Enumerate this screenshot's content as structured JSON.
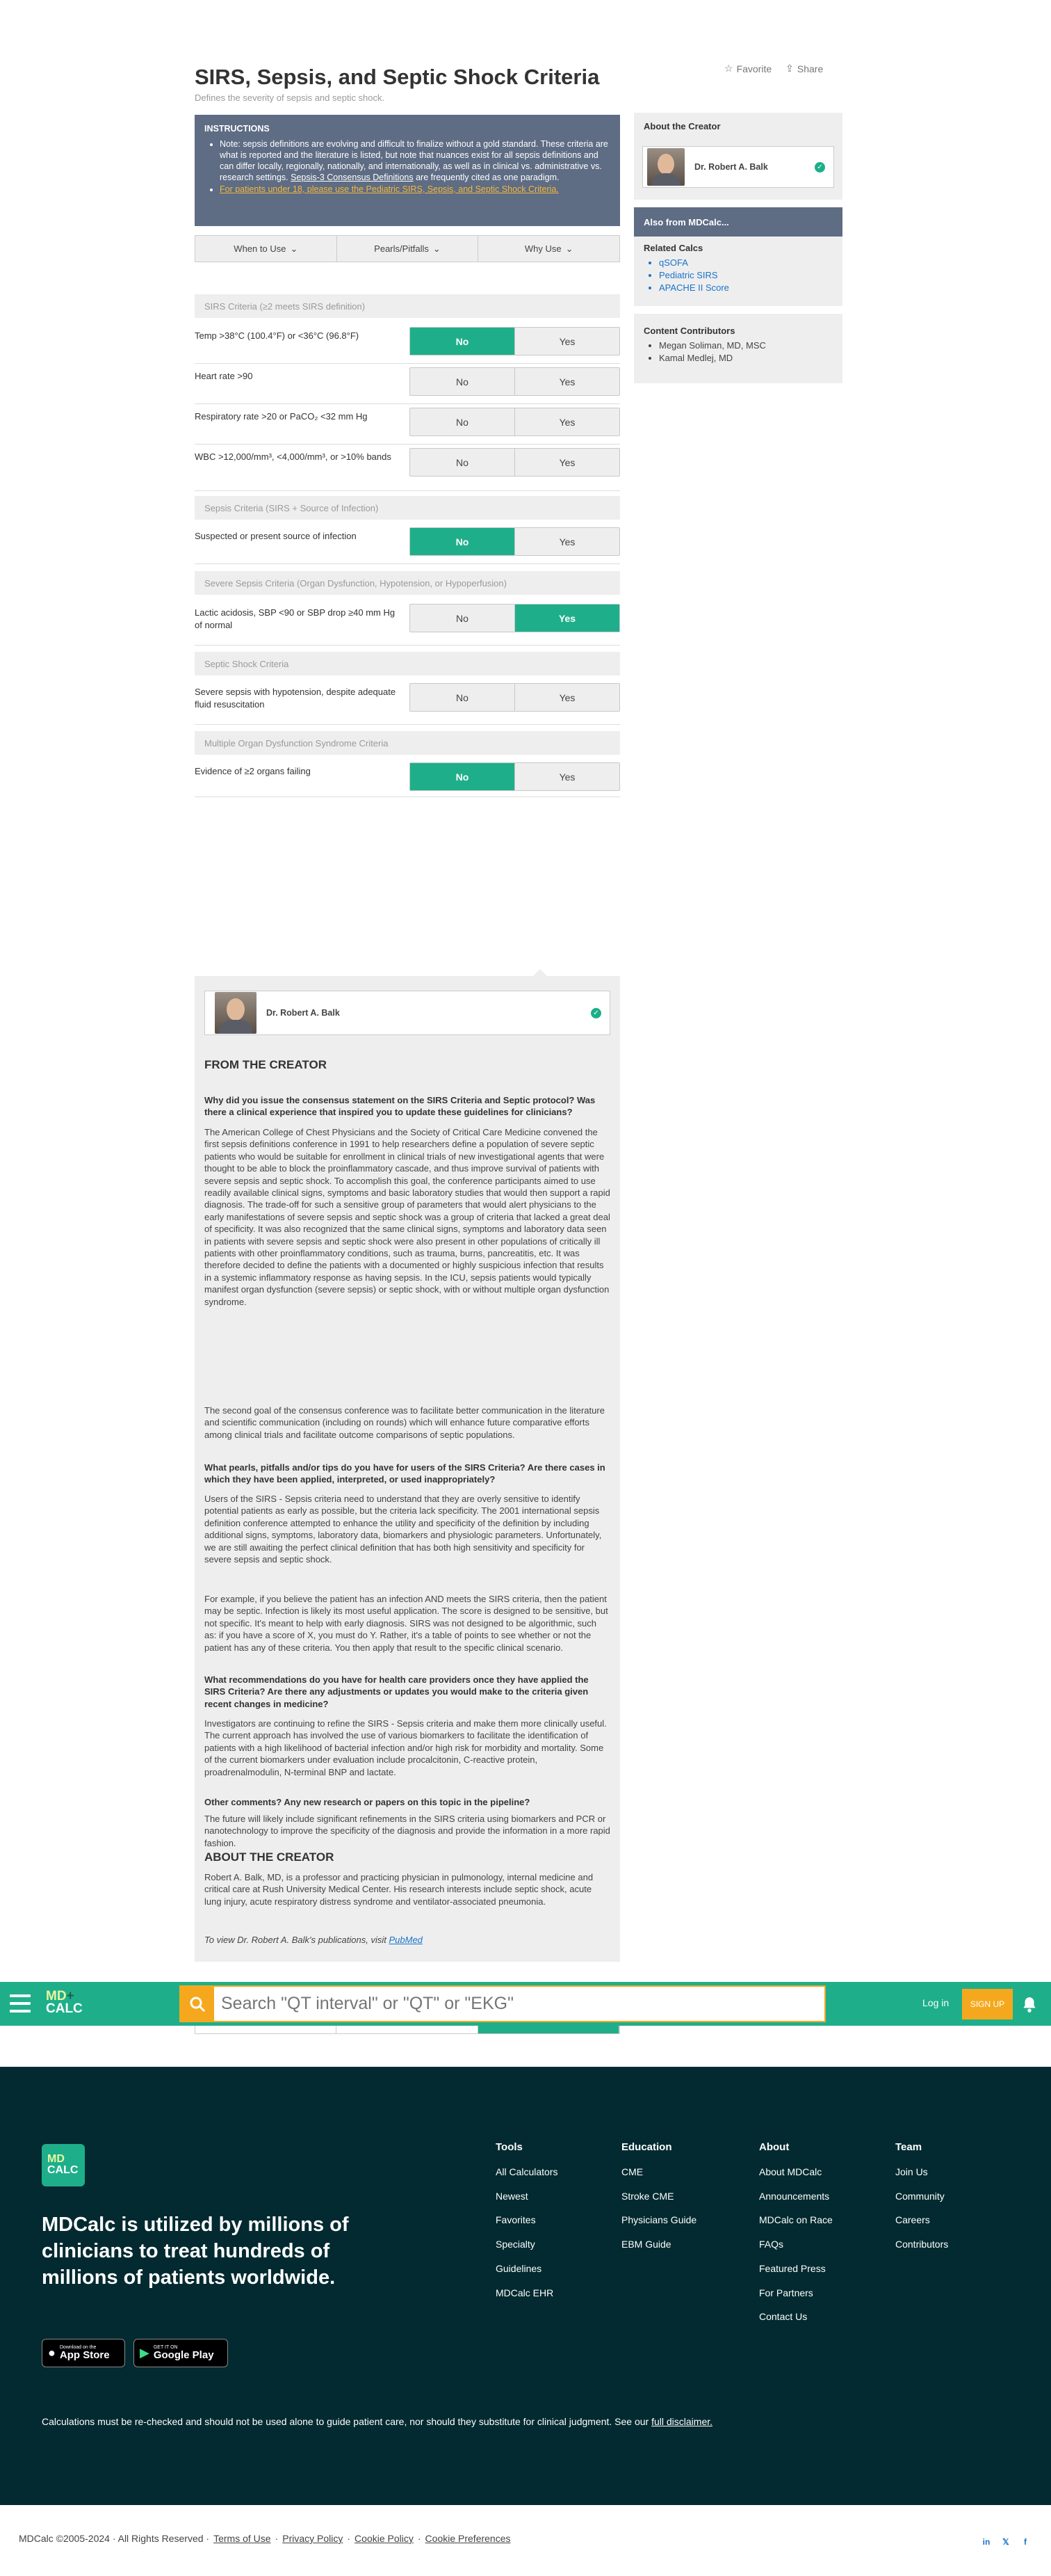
{
  "header": {
    "title": "SIRS, Sepsis, and Septic Shock Criteria",
    "subtitle": "Defines the severity of sepsis and septic shock.",
    "favorite": "Favorite",
    "share": "Share"
  },
  "instructions": {
    "heading": "INSTRUCTIONS",
    "note_text": "Note: sepsis definitions are evolving and difficult to finalize without a gold standard. These criteria are what is reported and the literature is listed, but note that nuances exist for all sepsis definitions and can differ locally, regionally, nationally, and internationally, as well as in clinical vs. administrative vs. research settings. ",
    "note_link": "Sepsis-3 Consensus Definitions",
    "note_tail": " are frequently cited as one paradigm.",
    "pediatric": "For patients under 18, please use the Pediatric SIRS, Sepsis, and Septic Shock Criteria."
  },
  "tabs": [
    "When to Use",
    "Pearls/Pitfalls",
    "Why Use"
  ],
  "sections": {
    "sirs": "SIRS Criteria (≥2 meets SIRS definition)",
    "sepsis": "Sepsis Criteria (SIRS + Source of Infection)",
    "severe": "Severe Sepsis Criteria (Organ Dysfunction, Hypotension, or Hypoperfusion)",
    "shock": "Septic Shock Criteria",
    "mods": "Multiple Organ Dysfunction Syndrome Criteria"
  },
  "criteria": [
    {
      "label": "Temp >38°C (100.4°F) or <36°C (96.8°F)",
      "selected": "No"
    },
    {
      "label": "Heart rate >90",
      "selected": "none"
    },
    {
      "label": "Respiratory rate >20 or PaCO₂ <32 mm Hg",
      "selected": "none"
    },
    {
      "label": "WBC >12,000/mm³, <4,000/mm³, or >10% bands",
      "selected": "none"
    },
    {
      "label": "Suspected or present source of infection",
      "selected": "No"
    },
    {
      "label": "Lactic acidosis, SBP <90 or SBP drop ≥40 mm Hg of normal",
      "selected": "Yes"
    },
    {
      "label": "Severe sepsis with hypotension, despite adequate fluid resuscitation",
      "selected": "none"
    },
    {
      "label": "Evidence of ≥2 organs failing",
      "selected": "No"
    }
  ],
  "toggle": {
    "no": "No",
    "yes": "Yes"
  },
  "sidebar": {
    "about_creator": "About the Creator",
    "creator_name": "Dr. Robert A. Balk",
    "also_from": "Also from MDCalc...",
    "related_title": "Related Calcs",
    "related": [
      "qSOFA",
      "Pediatric SIRS",
      "APACHE II Score"
    ],
    "contributors_title": "Content Contributors",
    "contributors": [
      "Megan Soliman, MD, MSC",
      "Kamal Medlej, MD"
    ]
  },
  "creator_panel": {
    "name": "Dr. Robert A. Balk",
    "from_heading": "FROM THE CREATOR",
    "q1": "Why did you issue the consensus statement on the SIRS Criteria and Septic protocol? Was there a clinical experience that inspired you to update these guidelines for clinicians?",
    "a1": "The American College of Chest Physicians and the Society of Critical Care Medicine convened the first sepsis definitions conference in 1991 to help researchers define a population of severe septic patients who would be suitable for enrollment in clinical trials of new investigational agents that were thought to be able to block the proinflammatory cascade, and thus improve survival of patients with severe sepsis and septic shock. To accomplish this goal, the conference participants aimed to use readily available clinical signs, symptoms and basic laboratory studies that would then support a rapid diagnosis. The trade-off for such a sensitive group of parameters that would alert physicians to the early manifestations of severe sepsis and septic shock was a group of criteria that lacked a great deal of specificity. It was also recognized that the same clinical signs, symptoms and laboratory data seen in patients with severe sepsis and septic shock were also present in other populations of critically ill patients with other proinflammatory conditions, such as trauma, burns, pancreatitis, etc. It was therefore decided to define the patients with a documented or highly suspicious infection that results in a systemic inflammatory response as having sepsis. In the ICU, sepsis patients would typically manifest organ dysfunction (severe sepsis) or septic shock, with or without multiple organ dysfunction syndrome.",
    "a1b": "The second goal of the consensus conference was to facilitate better communication in the literature and scientific communication (including on rounds) which will enhance future comparative efforts among clinical trials and facilitate outcome comparisons of septic populations.",
    "q2": "What pearls, pitfalls and/or tips do you have for users of the SIRS Criteria? Are there cases in which they have been applied, interpreted, or used inappropriately?",
    "a2": "Users of the SIRS - Sepsis criteria need to understand that they are overly sensitive to identify potential patients as early as possible, but the criteria lack specificity. The 2001 international sepsis definition conference attempted to enhance the utility and specificity of the definition by including additional signs, symptoms, laboratory data, biomarkers and physiologic parameters. Unfortunately, we are still awaiting the perfect clinical definition that has both high sensitivity and specificity for severe sepsis and septic shock.",
    "a2b": "For example, if you believe the patient has an infection AND meets the SIRS criteria, then the patient may be septic. Infection is likely its most useful application. The score is designed to be sensitive, but not specific. It's meant to help with early diagnosis. SIRS was not designed to be algorithmic, such as: if you have a score of X, you must do Y. Rather, it's a table of points to see whether or not the patient has any of these criteria. You then apply that result to the specific clinical scenario.",
    "q3": "What recommendations do you have for health care providers once they have applied the SIRS Criteria? Are there any adjustments or updates you would make to the criteria given recent changes in medicine?",
    "a3": "Investigators are continuing to refine the SIRS - Sepsis criteria and make them more clinically useful. The current approach has involved the use of various biomarkers to facilitate the identification of patients with a high likelihood of bacterial infection and/or high risk for morbidity and mortality. Some of the current biomarkers under evaluation include procalcitonin, C-reactive protein, proadrenalmodulin, N-terminal BNP and lactate.",
    "q4": "Other comments? Any new research or papers on this topic in the pipeline?",
    "a4": "The future will likely include significant refinements in the SIRS criteria using biomarkers and PCR or nanotechnology to improve the specificity of the diagnosis and provide the information in a more rapid fashion.",
    "about_heading": "ABOUT THE CREATOR",
    "about_text": "Robert A. Balk, MD, is a professor and practicing physician in pulmonology, internal medicine and critical care at Rush University Medical Center. His research interests include septic shock, acute lung injury, acute respiratory distress syndrome and ventilator-associated pneumonia.",
    "pubs_prefix": "To view Dr. Robert A. Balk's publications, visit ",
    "pubs_link": "PubMed"
  },
  "topbar": {
    "logo_top": "MD",
    "logo_bottom": "CALC",
    "search_placeholder": "Search \"QT interval\" or \"QT\" or \"EKG\"",
    "login": "Log in",
    "signup": "SIGN UP"
  },
  "footer": {
    "logo_top": "MD",
    "logo_bottom": "CALC",
    "tagline": "MDCalc is utilized by millions of clinicians to treat hundreds of millions of patients worldwide.",
    "appstore_small": "Download on the",
    "appstore": "App Store",
    "gplay_small": "GET IT ON",
    "gplay": "Google Play",
    "columns": [
      {
        "title": "Tools",
        "items": [
          "All Calculators",
          "Newest",
          "Favorites",
          "Specialty",
          "Guidelines",
          "MDCalc EHR"
        ]
      },
      {
        "title": "Education",
        "items": [
          "CME",
          "Stroke CME",
          "Physicians Guide",
          "EBM Guide"
        ]
      },
      {
        "title": "About",
        "items": [
          "About MDCalc",
          "Announcements",
          "MDCalc on Race",
          "FAQs",
          "Featured Press",
          "For Partners",
          "Contact Us"
        ]
      },
      {
        "title": "Team",
        "items": [
          "Join Us",
          "Community",
          "Careers",
          "Contributors"
        ]
      }
    ],
    "disclaimer": "Calculations must be re-checked and should not be used alone to guide patient care, nor should they substitute for clinical judgment. See our ",
    "disclaimer_link": "full disclaimer."
  },
  "bottom": {
    "copyright": "MDCalc ©2005-2024 · All Rights Reserved ·",
    "terms": "Terms of Use",
    "privacy": "Privacy Policy",
    "cookie": "Cookie Policy",
    "prefs": "Cookie Preferences",
    "sep": "·"
  },
  "colors": {
    "accent": "#1eaf8a",
    "instructions_bg": "#5e6c84",
    "search_accent": "#f5a81d",
    "footer_bg": "#022a30"
  }
}
